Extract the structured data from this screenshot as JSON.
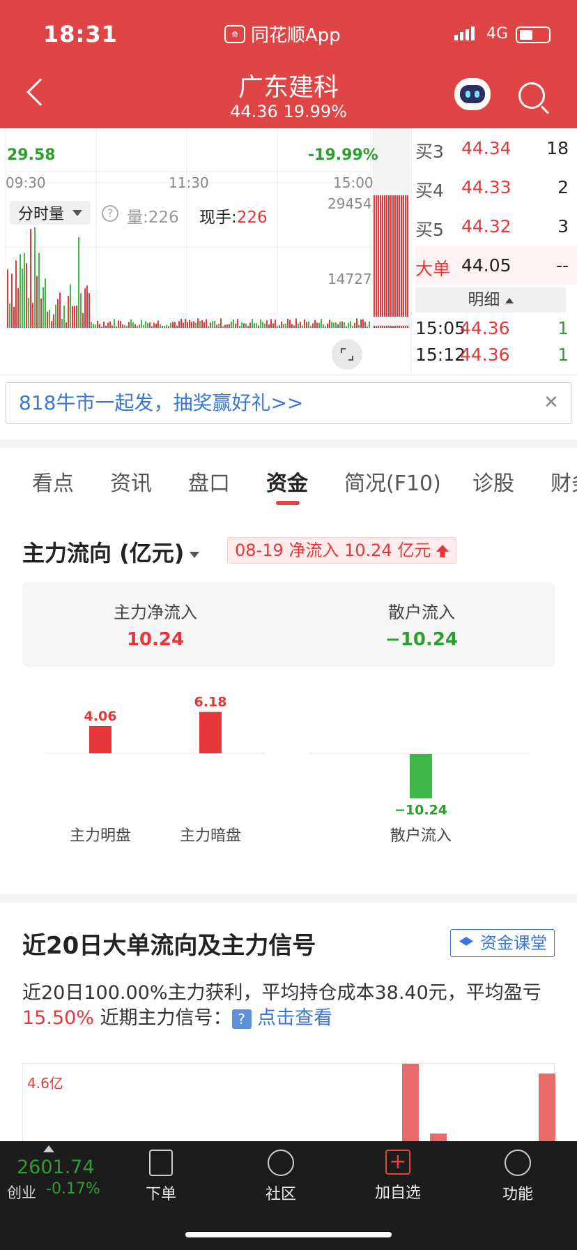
{
  "status_bar": {
    "time": "18:31",
    "app_name": "同花顺App",
    "network": "4G"
  },
  "header": {
    "title": "广东建科",
    "price": "44.36",
    "change_pct": "19.99%"
  },
  "chart": {
    "low_price": "29.58",
    "low_pct": "-19.99%",
    "times": [
      "09:30",
      "11:30",
      "15:00"
    ],
    "vol_max": "29454",
    "vol_mid": "14727",
    "tag_label": "分时量",
    "volume_label": "量:",
    "volume_value": "226",
    "current_label": "现手:",
    "current_value": "226"
  },
  "order_book": [
    {
      "label": "买3",
      "price": "44.34",
      "qty": "18"
    },
    {
      "label": "买4",
      "price": "44.33",
      "qty": "2"
    },
    {
      "label": "买5",
      "price": "44.32",
      "qty": "3"
    }
  ],
  "big_order": {
    "label": "大单",
    "price": "44.05",
    "qty": "--"
  },
  "detail": {
    "label": "明细",
    "rows": [
      {
        "time": "15:05",
        "price": "44.36",
        "qty": "1"
      },
      {
        "time": "15:12",
        "price": "44.36",
        "qty": "1"
      }
    ]
  },
  "promo": {
    "text": "818牛市一起发，抽奖赢好礼>>"
  },
  "tabs": [
    "看点",
    "资讯",
    "盘口",
    "资金",
    "简况(F10)",
    "诊股",
    "财务"
  ],
  "main_flow": {
    "title": "主力流向 (亿元)",
    "badge": "08-19 净流入 10.24 亿元",
    "main_net_label": "主力净流入",
    "main_net_value": "10.24",
    "retail_label": "散户流入",
    "retail_value": "−10.24"
  },
  "chart_data": {
    "type": "bar",
    "categories": [
      "主力明盘",
      "主力暗盘",
      "散户流入"
    ],
    "values": [
      4.06,
      6.18,
      -10.24
    ],
    "value_labels": [
      "4.06",
      "6.18",
      "−10.24"
    ],
    "colors": [
      "#e5373a",
      "#e5373a",
      "#3fb84a"
    ]
  },
  "section2": {
    "title": "近20日大单流向及主力信号",
    "course_button": "资金课堂",
    "para_1": "近20日100.00%主力获利，平均持仓成本38.40元，平均盈亏",
    "para_pct": "15.50%",
    "para_2": " 近期主力信号：",
    "para_link": "点击查看",
    "axis_label": "4.6亿"
  },
  "bottom_nav": {
    "index_value": "2601.74",
    "index_name": "创业",
    "index_change": "-0.17%",
    "items": [
      "下单",
      "社区",
      "加自选",
      "功能"
    ]
  }
}
